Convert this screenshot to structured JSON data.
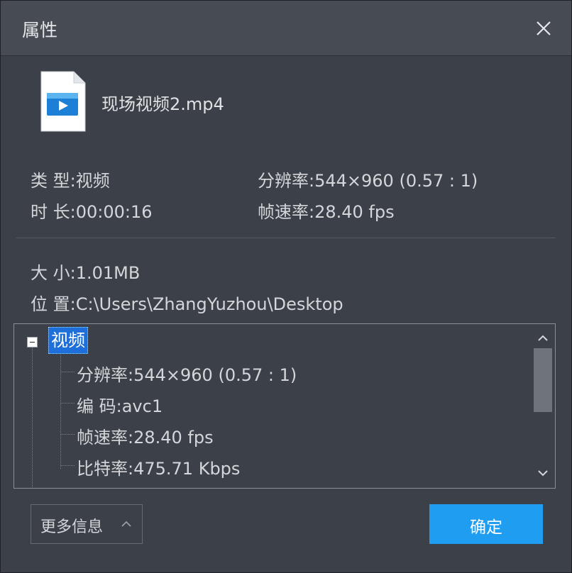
{
  "window": {
    "title": "属性"
  },
  "file": {
    "name": "现场视频2.mp4",
    "icon": "video-file-icon"
  },
  "summary": {
    "type_label": "类 型:",
    "type_value": "视频",
    "resolution_label": "分辨率:",
    "resolution_value": "544×960 (0.57 : 1)",
    "duration_label": "时 长:",
    "duration_value": "00:00:16",
    "framerate_label": "帧速率:",
    "framerate_value": "28.40 fps",
    "size_label": "大 小:",
    "size_value": "1.01MB",
    "location_label": "位 置:",
    "location_value": "C:\\Users\\ZhangYuzhou\\Desktop"
  },
  "tree": {
    "root_label": "视频",
    "children": [
      {
        "label": "分辨率:",
        "value": "544×960 (0.57 : 1)"
      },
      {
        "label": "编 码:",
        "value": "avc1"
      },
      {
        "label": "帧速率:",
        "value": "28.40 fps"
      },
      {
        "label": "比特率:",
        "value": "475.71 Kbps"
      }
    ]
  },
  "buttons": {
    "more_info": "更多信息",
    "ok": "确定"
  },
  "colors": {
    "accent": "#1f9df0",
    "selection": "#1e6fd9",
    "background": "#3c4048"
  }
}
